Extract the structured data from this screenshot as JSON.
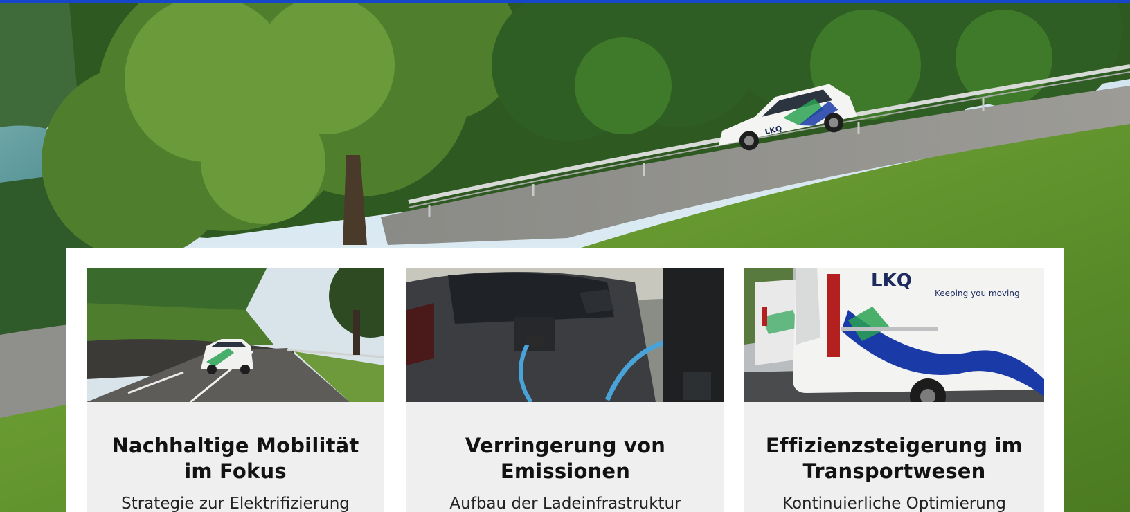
{
  "hero": {
    "vehicle_brand": "LKQ"
  },
  "cards": [
    {
      "title_line1": "Nachhaltige Mobilität",
      "title_line2": "im Fokus",
      "text": "Strategie zur Elektrifizierung",
      "image_desc": "LKQ car on a lakeside road"
    },
    {
      "title_line1": "Verringerung von",
      "title_line2": "Emissionen",
      "text": "Aufbau der Ladeinfrastruktur",
      "image_desc": "charging cable plugged into a dark car"
    },
    {
      "title_line1": "Effizienzsteigerung im",
      "title_line2": "Transportwesen",
      "text": "Kontinuierliche Optimierung",
      "image_brand": "LKQ",
      "image_slogan": "Keeping you moving"
    }
  ],
  "colors": {
    "topbar": "#1646c9",
    "card_bg": "#efefef",
    "panel_bg": "#ffffff",
    "brand_blue": "#1a3aa8",
    "brand_green": "#36b05a"
  }
}
